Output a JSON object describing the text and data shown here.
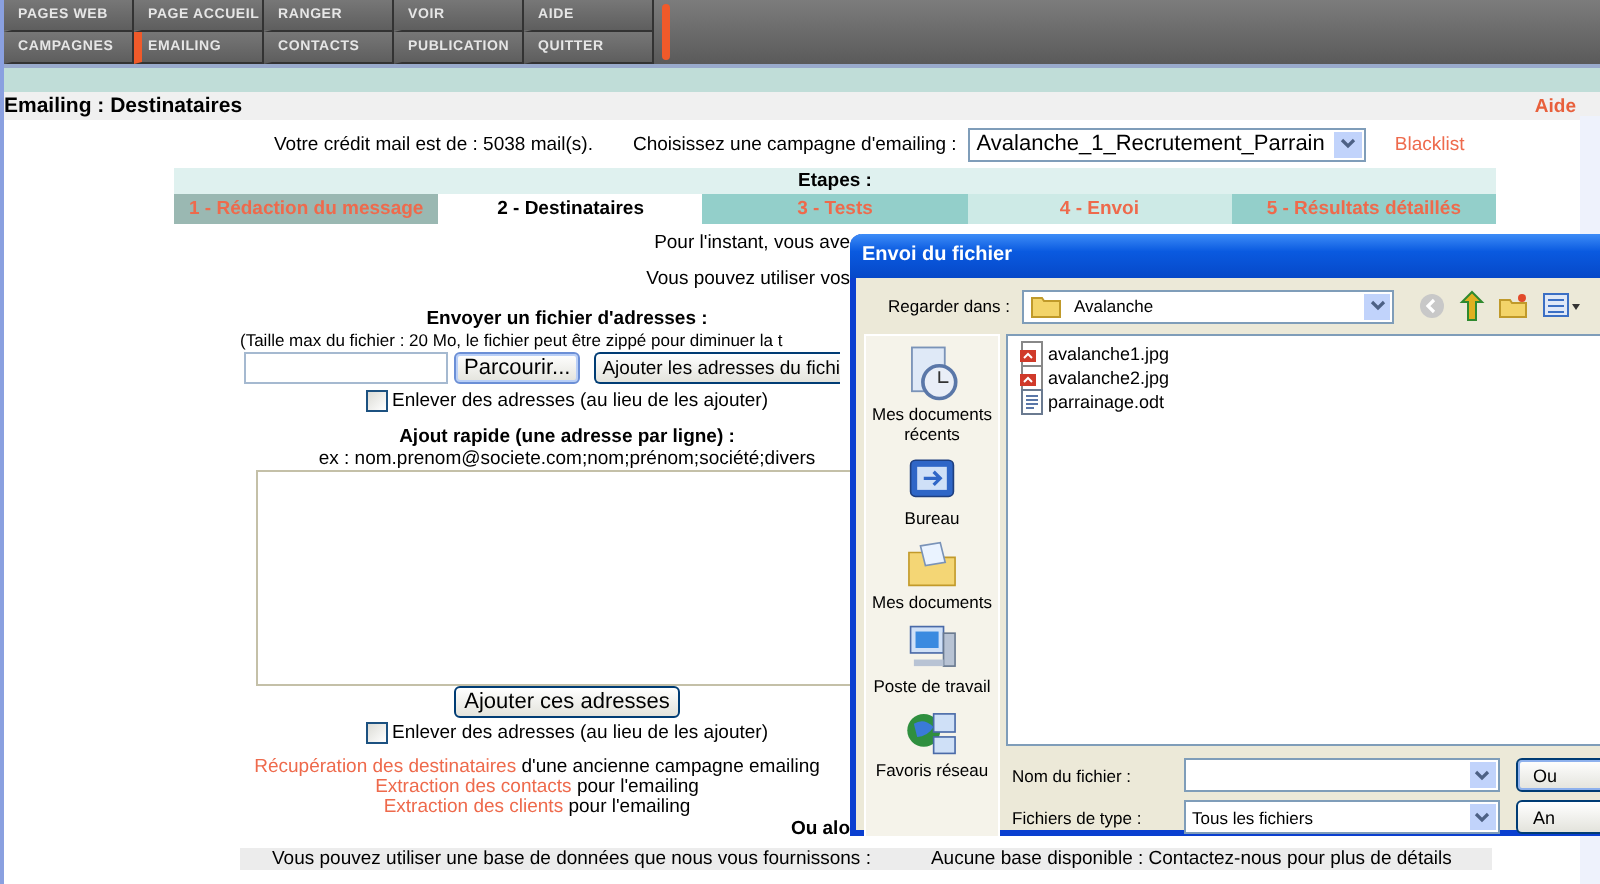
{
  "nav": {
    "rows": [
      [
        {
          "label": "PAGES WEB",
          "selected": false
        },
        {
          "label": "PAGE ACCUEIL",
          "selected": false
        },
        {
          "label": "RANGER",
          "selected": false
        },
        {
          "label": "VOIR",
          "selected": false
        },
        {
          "label": "AIDE",
          "selected": false
        }
      ],
      [
        {
          "label": "CAMPAGNES",
          "selected": false
        },
        {
          "label": "EMAILING",
          "selected": true
        },
        {
          "label": "CONTACTS",
          "selected": false
        },
        {
          "label": "PUBLICATION",
          "selected": false
        },
        {
          "label": "QUITTER",
          "selected": false
        }
      ]
    ]
  },
  "page_title": "Emailing : Destinataires",
  "help_link": "Aide",
  "credit": "Votre crédit mail est de : 5038 mail(s).",
  "campaign_label": "Choisissez une campagne d'emailing :",
  "campaign_value": "Avalanche_1_Recrutement_Parrain",
  "blacklist_link": "Blacklist",
  "steps_title": "Etapes :",
  "steps": [
    {
      "label": "1 - Rédaction du message",
      "selected": false
    },
    {
      "label": "2 - Destinataires",
      "selected": true
    },
    {
      "label": "3 - Tests",
      "selected": false
    },
    {
      "label": "4 - Envoi",
      "selected": false
    },
    {
      "label": "5 - Résultats détaillés",
      "selected": false
    }
  ],
  "info_lines": [
    "Pour l'instant, vous ave",
    "Vous pouvez utiliser vos"
  ],
  "upload": {
    "title": "Envoyer un fichier d'adresses :",
    "note": "(Taille max du fichier : 20 Mo, le fichier peut être zippé pour diminuer la t",
    "browse_button": "Parcourir...",
    "add_button": "Ajouter les adresses du fichi",
    "remove_label": "Enlever des adresses (au lieu de les ajouter)",
    "remove_checked": false
  },
  "quick": {
    "title": "Ajout rapide (une adresse par ligne) :",
    "example": "ex : nom.prenom@societe.com;nom;prénom;société;divers",
    "add_button": "Ajouter ces adresses",
    "remove_label": "Enlever des adresses (au lieu de les ajouter)",
    "remove_checked": false
  },
  "links": [
    {
      "link": "Récupération des destinataires",
      "rest": "d'une ancienne campagne emailing"
    },
    {
      "link": "Extraction des contacts",
      "rest": "pour l'emailing"
    },
    {
      "link": "Extraction des clients",
      "rest": "pour l'emailing"
    }
  ],
  "or_text": "Ou alo",
  "database": {
    "label": "Vous pouvez utiliser une base de données que nous vous fournissons :",
    "value": "Aucune base disponible : Contactez-nous pour plus de détails"
  },
  "dialog": {
    "title": "Envoi du fichier",
    "look_in_label": "Regarder dans :",
    "look_in_value": "Avalanche",
    "places": [
      "Mes documents récents",
      "Bureau",
      "Mes documents",
      "Poste de travail",
      "Favoris réseau"
    ],
    "files": [
      {
        "name": "avalanche1.jpg",
        "kind": "image"
      },
      {
        "name": "avalanche2.jpg",
        "kind": "image"
      },
      {
        "name": "parrainage.odt",
        "kind": "document"
      }
    ],
    "filename_label": "Nom du fichier :",
    "filetype_label": "Fichiers de type :",
    "filetype_value": "Tous les fichiers",
    "open_button": "Ou",
    "cancel_button": "An"
  }
}
